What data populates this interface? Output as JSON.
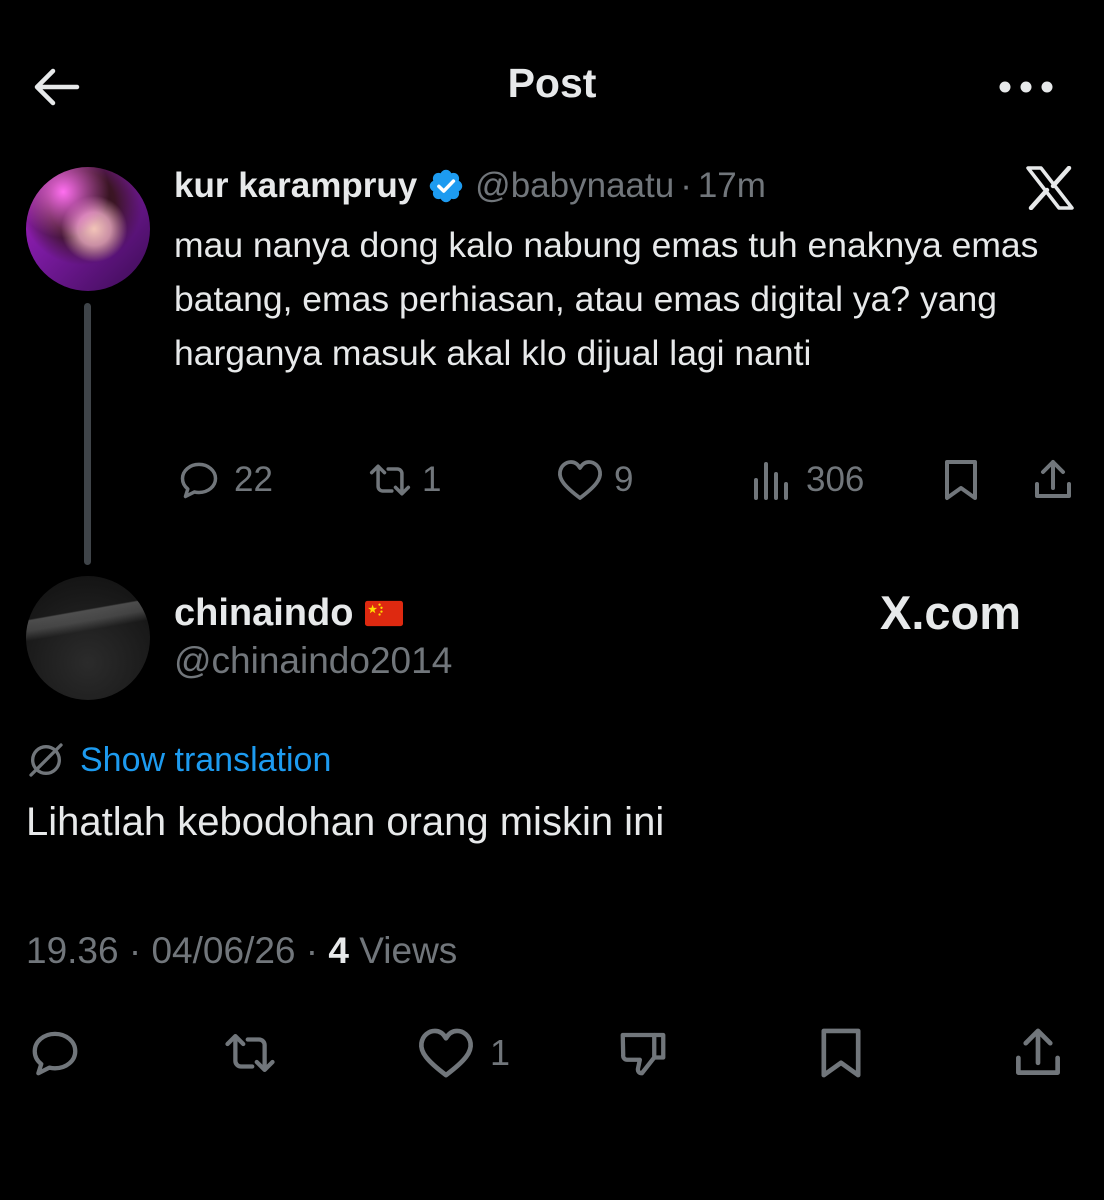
{
  "header": {
    "title": "Post",
    "back_icon": "arrow-left-icon",
    "more_icon": "more-horizontal-icon"
  },
  "quoted_tweet": {
    "author_name": "kur karampruy",
    "verified": true,
    "handle": "@babynaatu",
    "separator": "·",
    "time": "17m",
    "text": "mau nanya dong kalo nabung emas tuh enaknya emas batang, emas perhiasan, atau emas digital ya? yang harganya masuk akal klo dijual lagi nanti",
    "replies": "22",
    "retweets": "1",
    "likes": "9",
    "views": "306"
  },
  "reply": {
    "author_name": "chinaindo",
    "handle": "@chinaindo2014",
    "watermark": "X.com",
    "translate_label": "Show translation",
    "text": "Lihatlah kebodohan orang miskin ini",
    "meta": {
      "time": "19.36",
      "date": "04/06/26",
      "separator": "·",
      "views_count": "4",
      "views_label": "Views"
    },
    "likes": "1"
  },
  "colors": {
    "background": "#000000",
    "text": "#e7e9ea",
    "muted": "#71767b",
    "link": "#1d9bf0",
    "verified": "#1d9bf0",
    "thread_line": "#3f4449"
  }
}
